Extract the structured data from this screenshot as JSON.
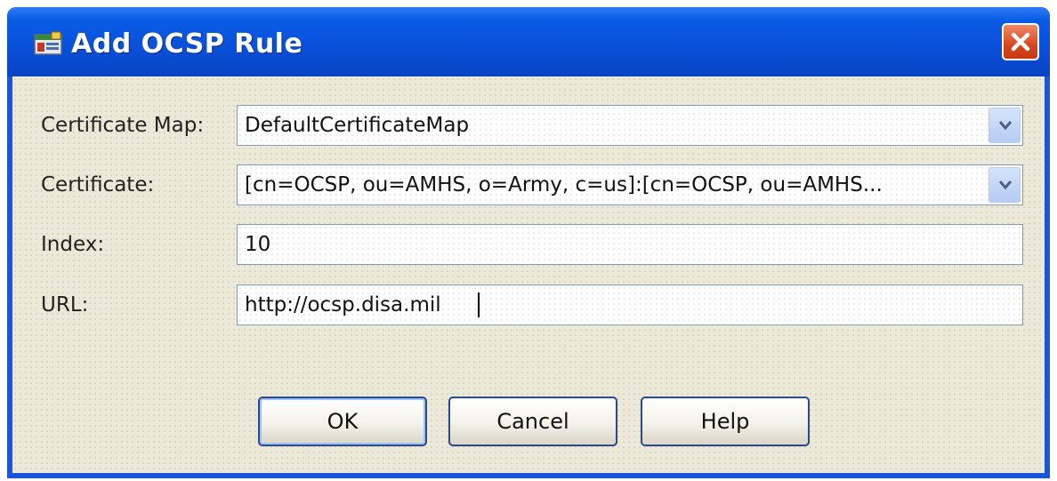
{
  "window": {
    "title": "Add  OCSP Rule",
    "app_icon": "asdm-icon",
    "close_icon": "close-icon"
  },
  "form": {
    "certificate_map": {
      "label": "Certificate Map:",
      "value": "DefaultCertificateMap"
    },
    "certificate": {
      "label": "Certificate:",
      "value": "[cn=OCSP, ou=AMHS, o=Army, c=us]:[cn=OCSP, ou=AMHS..."
    },
    "index": {
      "label": "Index:",
      "value": "10"
    },
    "url": {
      "label": "URL:",
      "value": "http://ocsp.disa.mil"
    }
  },
  "buttons": {
    "ok": "OK",
    "cancel": "Cancel",
    "help": "Help"
  },
  "colors": {
    "titlebar": "#0a4fd9",
    "close_button": "#d9461d",
    "dialog_background": "#ece9d8",
    "field_border": "#7f9db9",
    "button_border": "#2a4a8c"
  }
}
